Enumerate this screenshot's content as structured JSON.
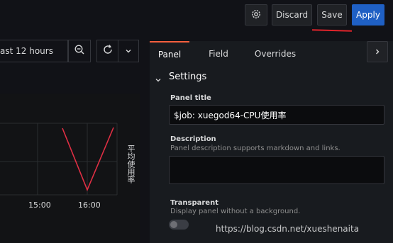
{
  "toolbar": {
    "settings_icon": "gear-icon",
    "discard_label": "Discard",
    "save_label": "Save",
    "apply_label": "Apply"
  },
  "timebar": {
    "time_range": "ast 12 hours",
    "zoom_icon": "zoom-out-icon",
    "refresh_icon": "refresh-icon",
    "dropdown_icon": "chevron-down-icon"
  },
  "graph": {
    "x_ticks": [
      "15:00",
      "16:00"
    ],
    "y_label": "平均使用率",
    "series_color": "#e02f44"
  },
  "options": {
    "tabs": [
      {
        "label": "Panel",
        "active": true
      },
      {
        "label": "Field",
        "active": false
      },
      {
        "label": "Overrides",
        "active": false
      }
    ],
    "collapse_icon": "chevron-right-icon",
    "section_title": "Settings",
    "panel_title_label": "Panel title",
    "panel_title_value": "$job: xuegod64-CPU使用率",
    "description_label": "Description",
    "description_help": "Panel description supports markdown and links.",
    "description_value": "",
    "transparent_label": "Transparent",
    "transparent_help": "Display panel without a background.",
    "transparent_on": false
  },
  "watermark": "https://blog.csdn.net/xueshenaita",
  "colors": {
    "accent": "#1f60c4",
    "tab_active": "#f55f3e",
    "annotation": "#e0242b"
  }
}
